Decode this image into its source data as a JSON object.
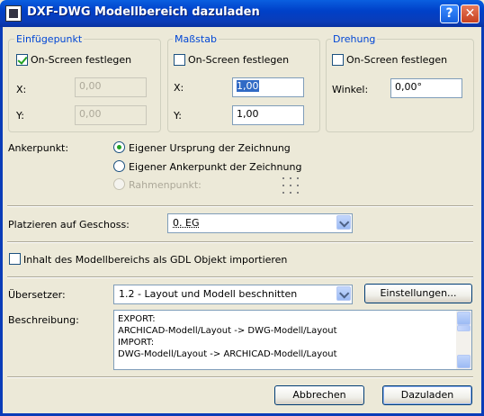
{
  "window": {
    "title": "DXF-DWG Modellbereich dazuladen",
    "help_label": "?",
    "close_label": "✕"
  },
  "insertion": {
    "title": "Einfügepunkt",
    "onscreen_label": "On-Screen festlegen",
    "onscreen_checked": true,
    "x_label": "X:",
    "x_value": "0,00",
    "y_label": "Y:",
    "y_value": "0,00"
  },
  "scale": {
    "title": "Maßstab",
    "onscreen_label": "On-Screen festlegen",
    "onscreen_checked": false,
    "x_label": "X:",
    "x_value": "1,00",
    "y_label": "Y:",
    "y_value": "1,00"
  },
  "rotation": {
    "title": "Drehung",
    "onscreen_label": "On-Screen festlegen",
    "onscreen_checked": false,
    "angle_label": "Winkel:",
    "angle_value": "0,00°"
  },
  "anchor": {
    "label": "Ankerpunkt:",
    "options": [
      {
        "label": "Eigener Ursprung der Zeichnung",
        "checked": true,
        "disabled": false
      },
      {
        "label": "Eigener Ankerpunkt der Zeichnung",
        "checked": false,
        "disabled": false
      },
      {
        "label": "Rahmenpunkt:",
        "checked": false,
        "disabled": true
      }
    ]
  },
  "story": {
    "label": "Platzieren auf Geschoss:",
    "value": "0. EG"
  },
  "gdl": {
    "label": "Inhalt des Modellbereichs als GDL Objekt importieren",
    "checked": false
  },
  "translator": {
    "label": "Übersetzer:",
    "value": "1.2 - Layout und Modell beschnitten",
    "settings_button": "Einstellungen..."
  },
  "description": {
    "label": "Beschreibung:",
    "lines": [
      "EXPORT:",
      "ARCHICAD-Modell/Layout -> DWG-Modell/Layout",
      "IMPORT:",
      "DWG-Modell/Layout -> ARCHICAD-Modell/Layout"
    ]
  },
  "footer": {
    "cancel": "Abbrechen",
    "ok": "Dazuladen"
  }
}
